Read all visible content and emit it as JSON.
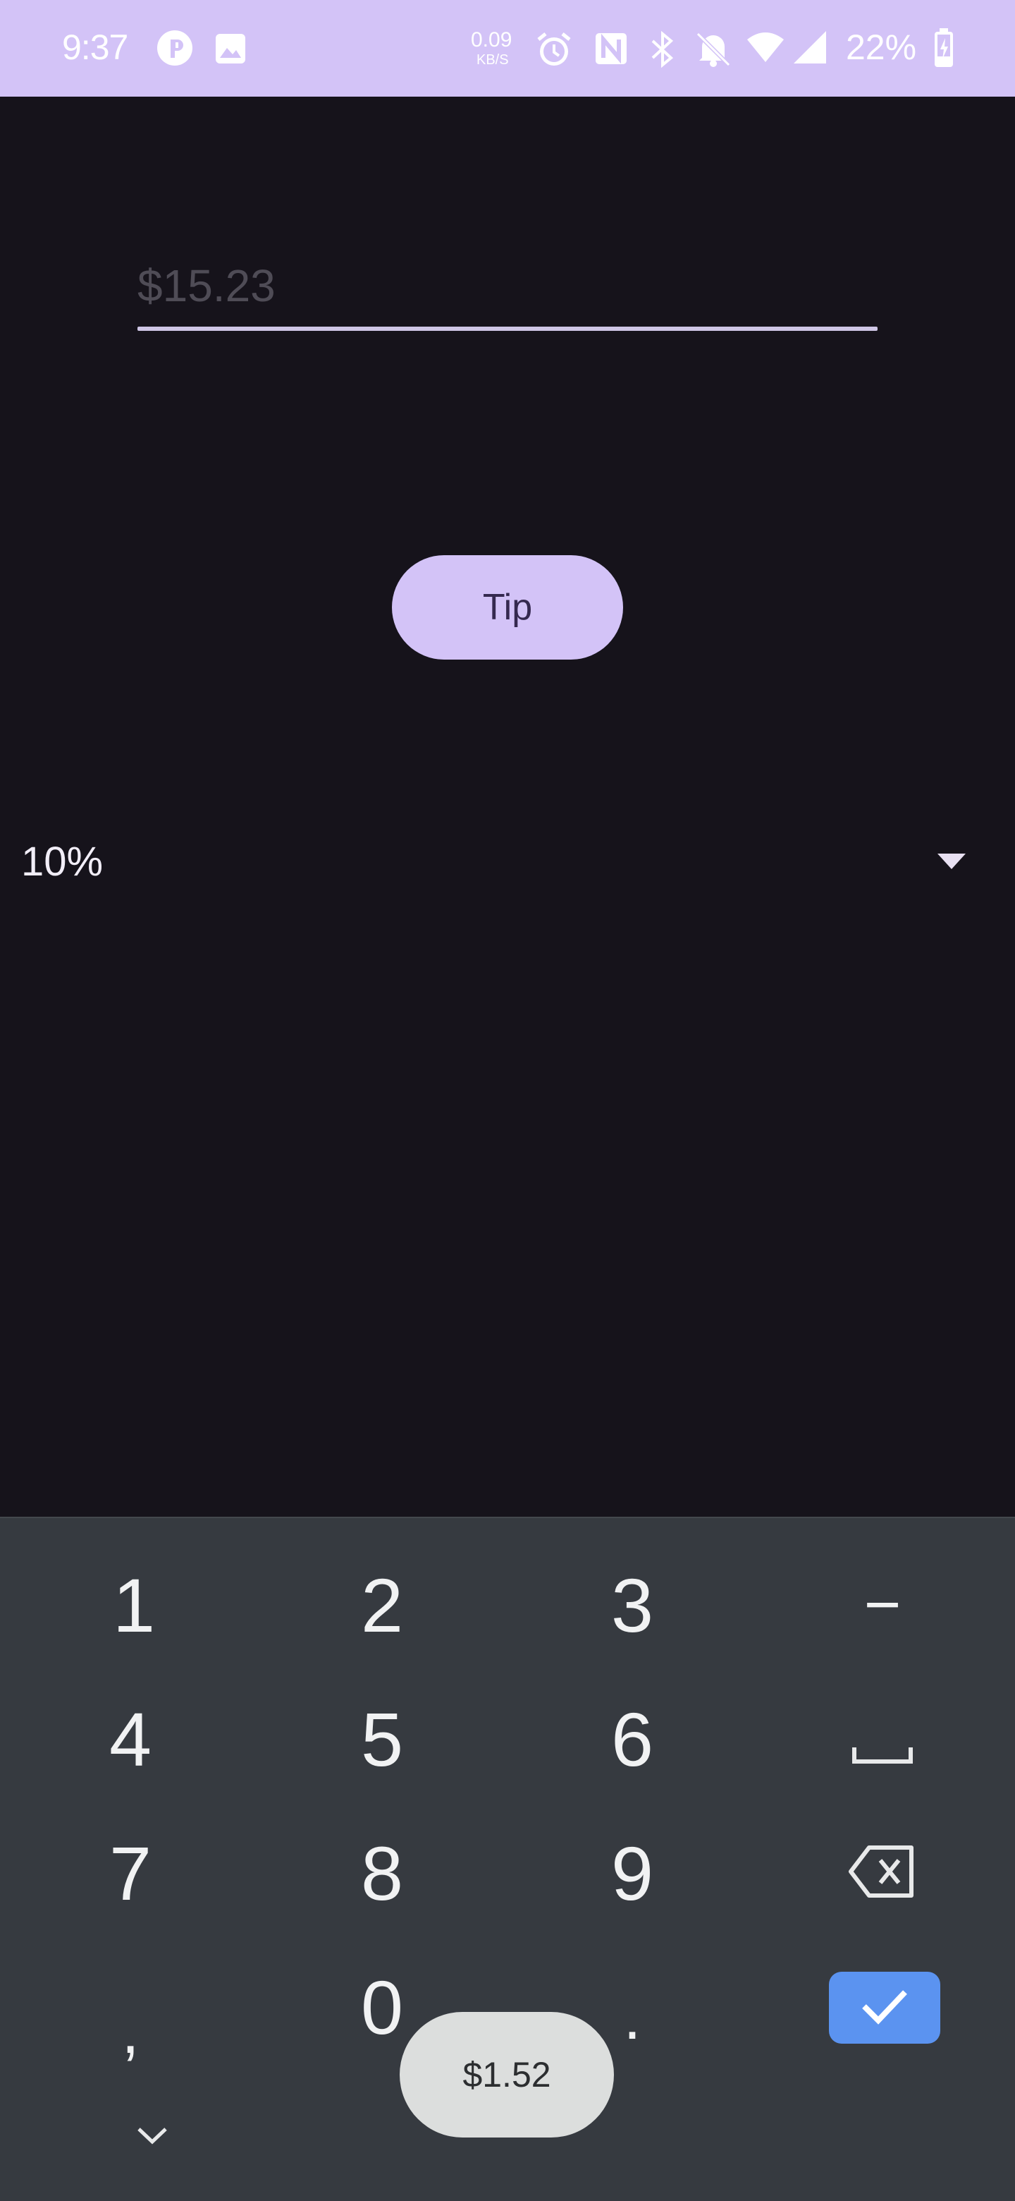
{
  "status_bar": {
    "time": "9:37",
    "net_speed_value": "0.09",
    "net_speed_unit": "KB/S",
    "battery": "22%",
    "icons": [
      "facebook-icon",
      "gallery-icon",
      "alarm-icon",
      "nfc-icon",
      "bluetooth-icon",
      "mute-icon",
      "wifi-icon",
      "signal-icon",
      "battery-charging-icon"
    ]
  },
  "bill": {
    "placeholder": "$15.23",
    "value": ""
  },
  "tip_button": {
    "label": "Tip"
  },
  "percent_spinner": {
    "selected": "10%"
  },
  "keyboard": {
    "rows": [
      [
        "1",
        "2",
        "3",
        "−"
      ],
      [
        "4",
        "5",
        "6",
        "space"
      ],
      [
        "7",
        "8",
        "9",
        "backspace"
      ],
      [
        ",",
        "0",
        ".",
        "done"
      ]
    ],
    "key_1": "1",
    "key_2": "2",
    "key_3": "3",
    "key_minus": "−",
    "key_4": "4",
    "key_5": "5",
    "key_6": "6",
    "key_7": "7",
    "key_8": "8",
    "key_9": "9",
    "key_comma": ",",
    "key_0": "0",
    "key_period": ".",
    "suggestion": "$1.52"
  },
  "colors": {
    "accent": "#d3c3f7",
    "background": "#16131b",
    "keyboard_bg": "#363a40",
    "done_key": "#5b93f0"
  }
}
